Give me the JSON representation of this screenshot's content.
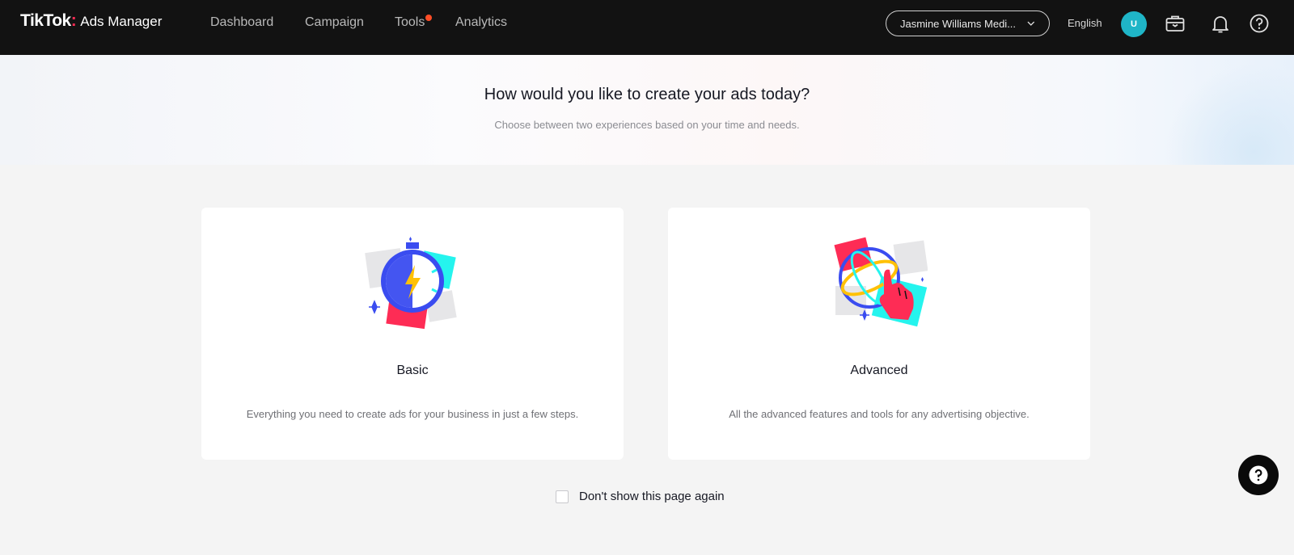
{
  "header": {
    "brand": "TikTok",
    "brand_suffix": "Ads Manager",
    "nav": [
      {
        "label": "Dashboard"
      },
      {
        "label": "Campaign"
      },
      {
        "label": "Tools",
        "has_notification_dot": true
      },
      {
        "label": "Analytics"
      }
    ],
    "account": "Jasmine Williams Medi...",
    "language": "English",
    "avatar_initial": "U",
    "icons": [
      "briefcase-icon",
      "bell-icon",
      "help-icon"
    ]
  },
  "hero": {
    "title": "How would you like to create your ads today?",
    "subtitle": "Choose between two experiences based on your time and needs."
  },
  "cards": [
    {
      "title": "Basic",
      "description": "Everything you need to create ads for your business in just a few steps.",
      "icon": "stopwatch-lightning-icon"
    },
    {
      "title": "Advanced",
      "description": "All the advanced features and tools for any advertising objective.",
      "icon": "globe-hand-icon"
    }
  ],
  "dont_show": {
    "label": "Don't show this page again",
    "checked": false
  },
  "colors": {
    "topbar": "#121212",
    "avatar": "#1fb5c7",
    "notification_dot": "#ff4d26",
    "accent_red": "#fe2c55",
    "accent_cyan": "#25f4ee"
  }
}
